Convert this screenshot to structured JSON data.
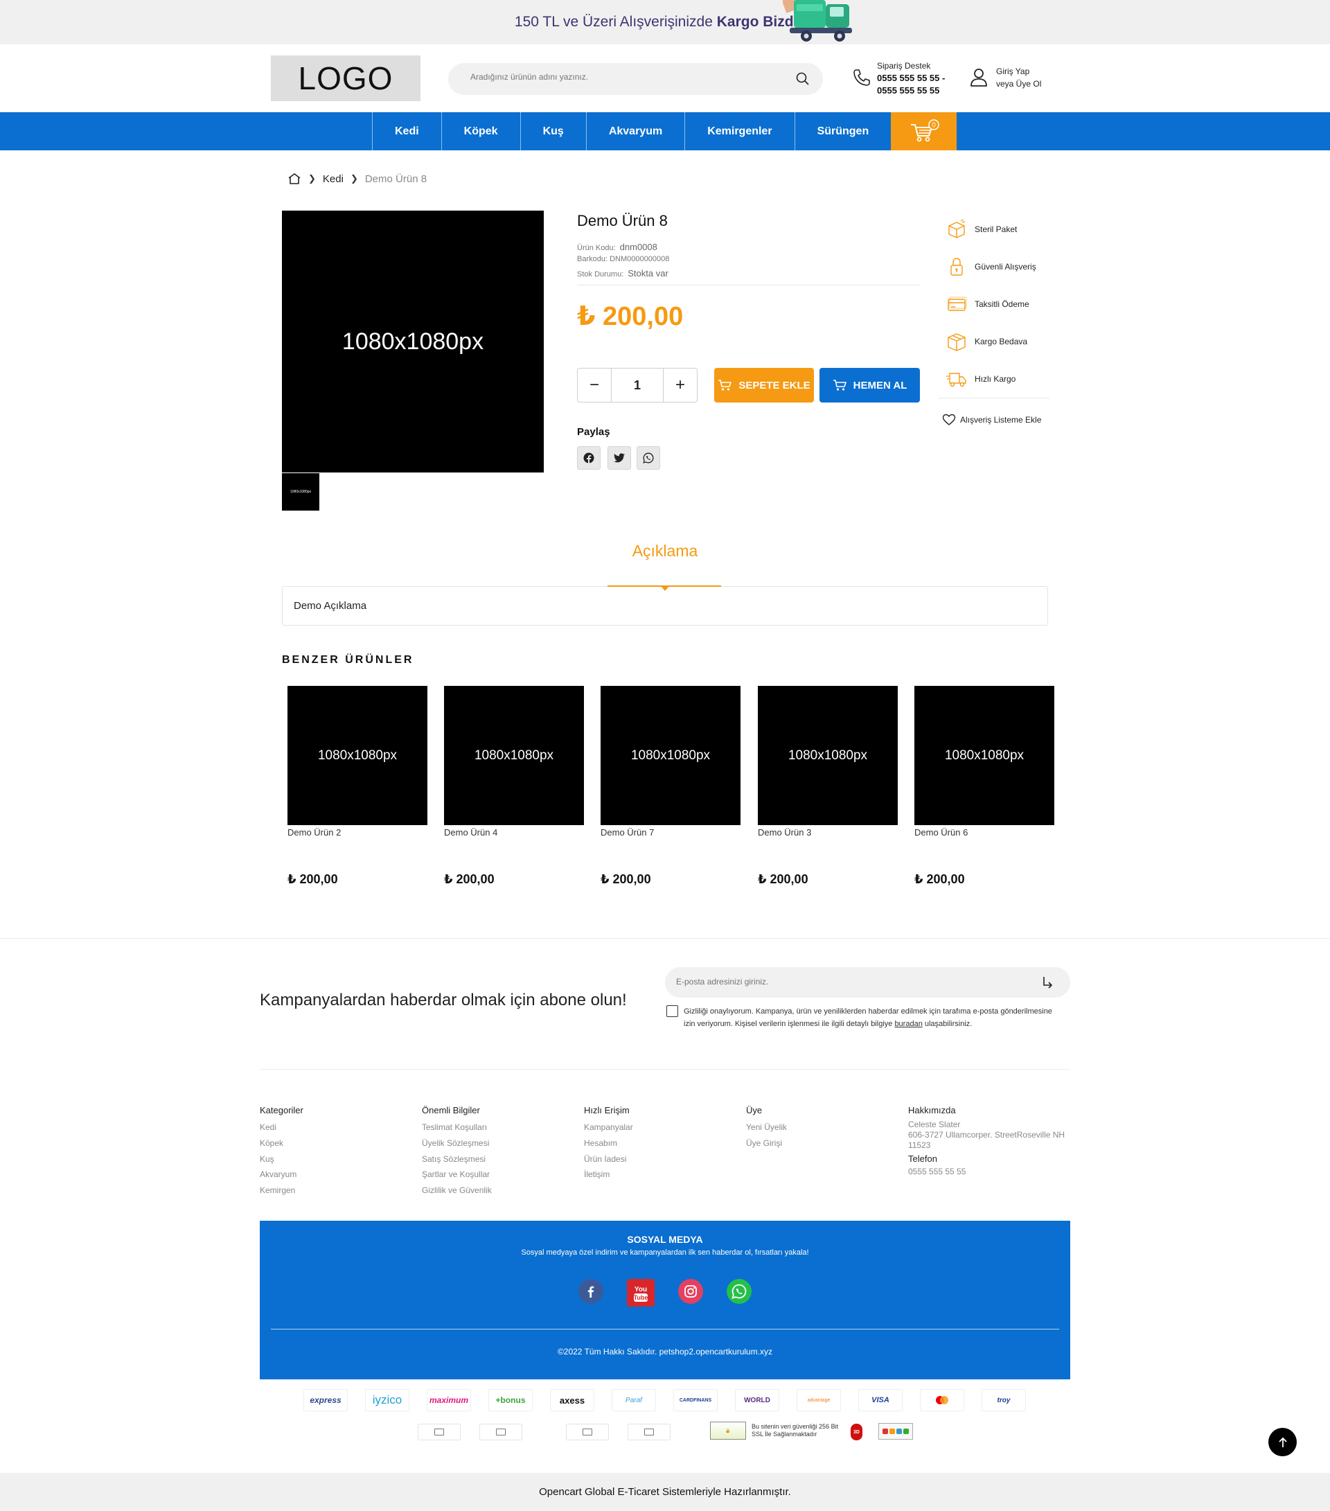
{
  "topbar": {
    "message_prefix": "150 TL ve Üzeri Alışverişinizde ",
    "message_bold": "Kargo Bizden!"
  },
  "header": {
    "logo": "LOGO",
    "search_placeholder": "Aradığınız ürünün adını yazınız.",
    "support_title": "Sipariş Destek",
    "support_phone_1": "0555 555 55 55 -",
    "support_phone_2": "0555 555 55 55",
    "login": "Giriş Yap",
    "register": "veya Üye Ol"
  },
  "nav": {
    "items": [
      "Kedi",
      "Köpek",
      "Kuş",
      "Akvaryum",
      "Kemirgenler",
      "Sürüngen"
    ],
    "cart_count": "0"
  },
  "breadcrumb": {
    "category": "Kedi",
    "current": "Demo Ürün 8"
  },
  "product": {
    "image_label": "1080x1080px",
    "thumb_label": "1080x1080px",
    "title": "Demo Ürün 8",
    "code_label": "Ürün Kodu:",
    "code_value": "dnm0008",
    "barcode_label": "Barkodu:",
    "barcode_value": "DNM0000000008",
    "stock_label": "Stok Durumu:",
    "stock_value": "Stokta var",
    "price": "₺ 200,00",
    "quantity": "1",
    "add_to_cart": "SEPETE EKLE",
    "buy_now": "HEMEN AL",
    "share_label": "Paylaş"
  },
  "features": [
    "Steril Paket",
    "Güvenli Alışveriş",
    "Taksitli Ödeme",
    "Kargo Bedava",
    "Hızlı Kargo"
  ],
  "wishlist": "Alışveriş Listeme Ekle",
  "description": {
    "tab": "Açıklama",
    "text": "Demo Açıklama"
  },
  "similar": {
    "title": "BENZER ÜRÜNLER",
    "items": [
      {
        "image_label": "1080x1080px",
        "name": "Demo Ürün 2",
        "price": "₺ 200,00"
      },
      {
        "image_label": "1080x1080px",
        "name": "Demo Ürün 4",
        "price": "₺ 200,00"
      },
      {
        "image_label": "1080x1080px",
        "name": "Demo Ürün 7",
        "price": "₺ 200,00"
      },
      {
        "image_label": "1080x1080px",
        "name": "Demo Ürün 3",
        "price": "₺ 200,00"
      },
      {
        "image_label": "1080x1080px",
        "name": "Demo Ürün 6",
        "price": "₺ 200,00"
      }
    ]
  },
  "newsletter": {
    "title": "Kampanyalardan haberdar olmak için abone olun!",
    "placeholder": "E-posta adresinizi giriniz.",
    "consent_before": "Gizliliği onaylıyorum. Kampanya, ürün ve yeniliklerden haberdar edilmek için tarafıma e-posta gönderilmesine izin veriyorum. Kişisel verilerin işlenmesi ile ilgili detaylı bilgiye ",
    "consent_link": "buradan",
    "consent_after": " ulaşabilirsiniz."
  },
  "footer": {
    "categories": {
      "title": "Kategoriler",
      "links": [
        "Kedi",
        "Köpek",
        "Kuş",
        "Akvaryum",
        "Kemirgen"
      ]
    },
    "info": {
      "title": "Önemli Bilgiler",
      "links": [
        "Teslimat Koşulları",
        "Üyelik Sözleşmesi",
        "Satış Sözleşmesi",
        "Şartlar ve Koşullar",
        "Gizlilik ve Güvenlik"
      ]
    },
    "quick": {
      "title": "Hızlı Erişim",
      "links": [
        "Kampanyalar",
        "Hesabım",
        "Ürün İadesi",
        "İletişim"
      ]
    },
    "member": {
      "title": "Üye",
      "links": [
        "Yeni Üyelik",
        "Üye Girişi"
      ]
    },
    "about": {
      "title": "Hakkımızda",
      "name": "Celeste Slater",
      "address": "606-3727 Ullamcorper. StreetRoseville NH 11523",
      "phone_label": "Telefon",
      "phone": "0555 555 55 55"
    }
  },
  "social": {
    "title": "SOSYAL MEDYA",
    "subtitle": "Sosyal medyaya özel indirim ve kampanyalardan ilk sen haberdar ol, fırsatları yakala!",
    "copyright": "©2022 Tüm Hakkı Saklıdır. petshop2.opencartkurulum.xyz"
  },
  "payments": [
    "express",
    "iyzico",
    "maximum",
    "+bonus",
    "axess",
    "Paraf",
    "CARDFINANS",
    "WORLD",
    "advantage",
    "VISA",
    "mastercard",
    "troy"
  ],
  "ssl_text": "Bu sitenin veri güvenliği 256 Bit SSL İle Sağlanmaktadır",
  "bottom_bar": "Opencart Global E-Ticaret Sistemleriyle Hazırlanmıştır.",
  "colors": {
    "primary": "#0a6fd0",
    "accent": "#f59a12"
  }
}
